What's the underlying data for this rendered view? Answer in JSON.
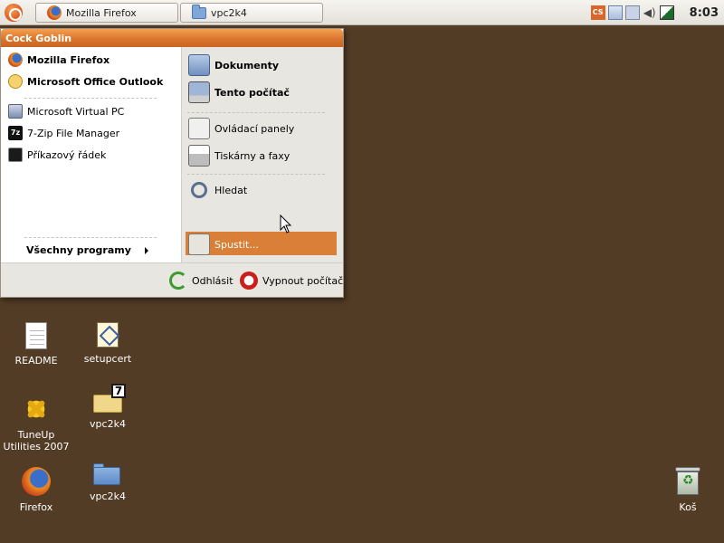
{
  "taskbar": {
    "tasks": [
      {
        "label": "Mozilla Firefox",
        "icon": "firefox-icon"
      },
      {
        "label": "vpc2k4",
        "icon": "folder-icon"
      }
    ],
    "tray_icons": [
      "cs-icon",
      "network-icon",
      "bluetooth-icon",
      "volume-icon",
      "battery-icon"
    ],
    "clock": "8:03"
  },
  "start_menu": {
    "user_name": "Cock Goblin",
    "pinned": [
      {
        "label": "Mozilla Firefox",
        "icon": "firefox-icon"
      },
      {
        "label": "Microsoft Office Outlook",
        "icon": "outlook-icon"
      }
    ],
    "recent": [
      {
        "label": "Microsoft Virtual PC",
        "icon": "virtual-pc-icon"
      },
      {
        "label": "7-Zip File Manager",
        "icon": "7zip-icon"
      },
      {
        "label": "Příkazový řádek",
        "icon": "command-prompt-icon"
      }
    ],
    "all_programs": "Všechny programy",
    "places": [
      {
        "label": "Dokumenty",
        "icon": "documents-icon"
      },
      {
        "label": "Tento počítač",
        "icon": "computer-icon"
      }
    ],
    "system": [
      {
        "label": "Ovládací panely",
        "icon": "control-panel-icon"
      },
      {
        "label": "Tiskárny a faxy",
        "icon": "printer-icon"
      }
    ],
    "tools": [
      {
        "label": "Hledat",
        "icon": "search-icon"
      },
      {
        "label": "Spustit...",
        "icon": "run-icon"
      }
    ],
    "logout": "Odhlásit",
    "shutdown": "Vypnout počítač"
  },
  "desktop": [
    {
      "label": "README",
      "icon": "text-document-icon"
    },
    {
      "label": "setupcert",
      "icon": "certificate-icon"
    },
    {
      "label": "TuneUp Utilities 2007",
      "icon": "tuneup-icon"
    },
    {
      "label": "vpc2k4",
      "icon": "zip-folder-icon"
    },
    {
      "label": "Firefox",
      "icon": "firefox-icon"
    },
    {
      "label": "vpc2k4",
      "icon": "folder-icon"
    },
    {
      "label": "Koš",
      "icon": "trash-icon"
    }
  ],
  "colors": {
    "desktop": "#523c26",
    "menu_header": "#d8732b",
    "highlight": "#d97f37",
    "menu_right_pane": "#e8e6e1"
  }
}
